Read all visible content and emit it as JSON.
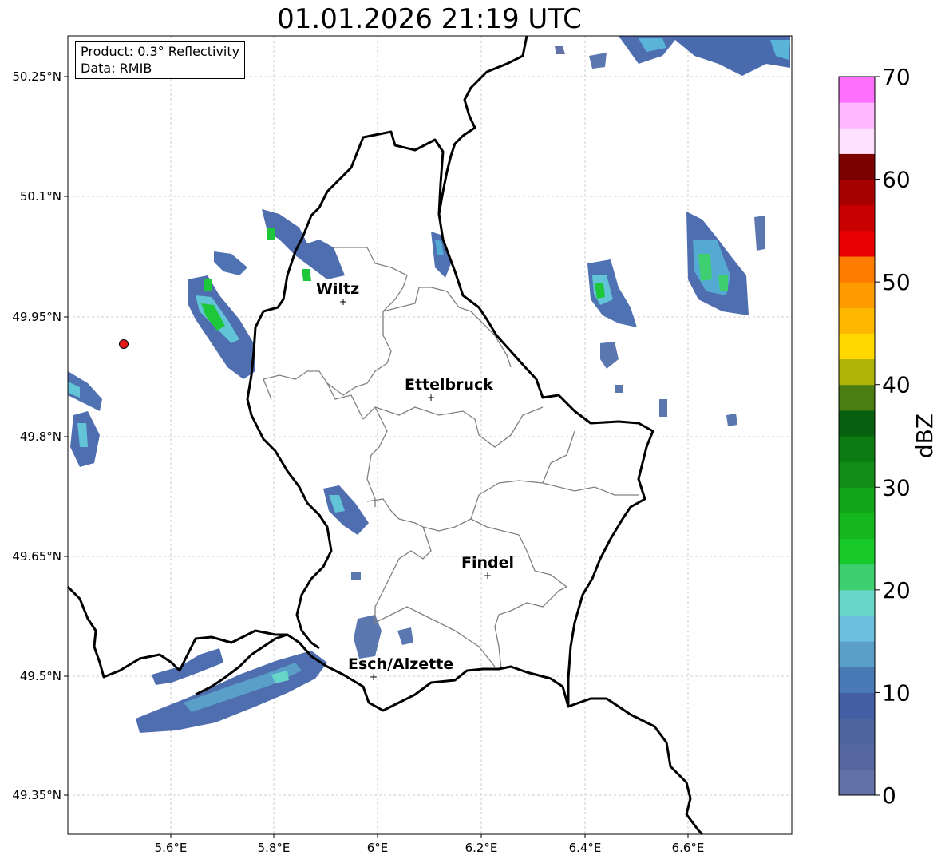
{
  "title": "01.01.2026 21:19 UTC",
  "info_box": {
    "product": "Product: 0.3° Reflectivity",
    "data": "Data: RMIB"
  },
  "map": {
    "lat_ticks": [
      "50.25°N",
      "50.1°N",
      "49.95°N",
      "49.8°N",
      "49.65°N",
      "49.5°N",
      "49.35°N"
    ],
    "lon_ticks": [
      "5.6°E",
      "5.8°E",
      "6°E",
      "6.2°E",
      "6.4°E",
      "6.6°E"
    ],
    "gridlines": true,
    "cities": [
      {
        "name": "Wiltz",
        "lat": 49.97,
        "lon": 5.93
      },
      {
        "name": "Ettelbruck",
        "lat": 49.85,
        "lon": 6.1
      },
      {
        "name": "Findel",
        "lat": 49.63,
        "lon": 6.21
      },
      {
        "name": "Esch/Alzette",
        "lat": 49.5,
        "lon": 5.99
      }
    ],
    "radar_site_color": "#e31a1c",
    "border_color": "#000000",
    "canton_color": "#808080"
  },
  "colorbar": {
    "label": "dBZ",
    "tick_labels": [
      "0",
      "10",
      "20",
      "30",
      "40",
      "50",
      "60",
      "70"
    ],
    "min": 0,
    "max": 70,
    "step": 2.5,
    "colors": [
      "#6272a8",
      "#5666a0",
      "#4f649e",
      "#445ea3",
      "#4a7ab5",
      "#5a9fc8",
      "#6cc0de",
      "#68d6c8",
      "#3dcf70",
      "#17c929",
      "#14b81e",
      "#12a61a",
      "#0f8d16",
      "#0c7c12",
      "#075f10",
      "#4a7d12",
      "#b0b409",
      "#ffd800",
      "#ffb800",
      "#ff9a00",
      "#ff7c00",
      "#e80000",
      "#c80000",
      "#a60000",
      "#7d0000",
      "#ffe0ff",
      "#ffb8ff",
      "#ff70ff",
      "#e838e8"
    ]
  }
}
